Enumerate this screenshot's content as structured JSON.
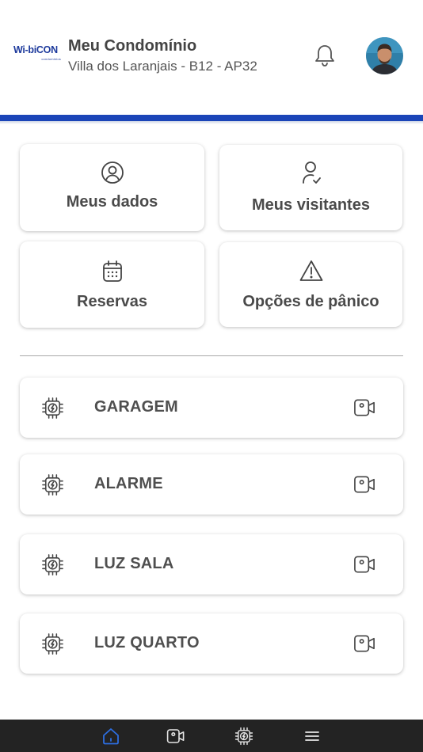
{
  "header": {
    "logo_text": "Wi-biCON",
    "logo_sub": "condominios",
    "title": "Meu Condomínio",
    "subtitle": "Villa dos Laranjais - B12 - AP32",
    "bell_icon": "bell-icon",
    "avatar": "user-avatar"
  },
  "colors": {
    "brand_blue": "#1b45b8",
    "text": "#4a4a4a",
    "nav_bg": "#232323",
    "nav_active": "#2d6ee0"
  },
  "menu_cards": [
    {
      "label": "Meus dados",
      "icon": "user-circle-icon"
    },
    {
      "label": "Meus visitantes",
      "icon": "user-check-icon"
    },
    {
      "label": "Reservas",
      "icon": "calendar-icon"
    },
    {
      "label": "Opções de pânico",
      "icon": "warning-triangle-icon"
    }
  ],
  "devices": [
    {
      "name": "GARAGEM",
      "icon": "chip-icon",
      "action_icon": "video-camera-icon"
    },
    {
      "name": "ALARME",
      "icon": "chip-icon",
      "action_icon": "video-camera-icon"
    },
    {
      "name": "LUZ SALA",
      "icon": "chip-icon",
      "action_icon": "video-camera-icon"
    },
    {
      "name": "LUZ QUARTO",
      "icon": "chip-icon",
      "action_icon": "video-camera-icon"
    }
  ],
  "bottom_nav": [
    {
      "icon": "home-icon",
      "active": true
    },
    {
      "icon": "video-camera-icon",
      "active": false
    },
    {
      "icon": "chip-icon",
      "active": false
    },
    {
      "icon": "menu-icon",
      "active": false
    }
  ]
}
